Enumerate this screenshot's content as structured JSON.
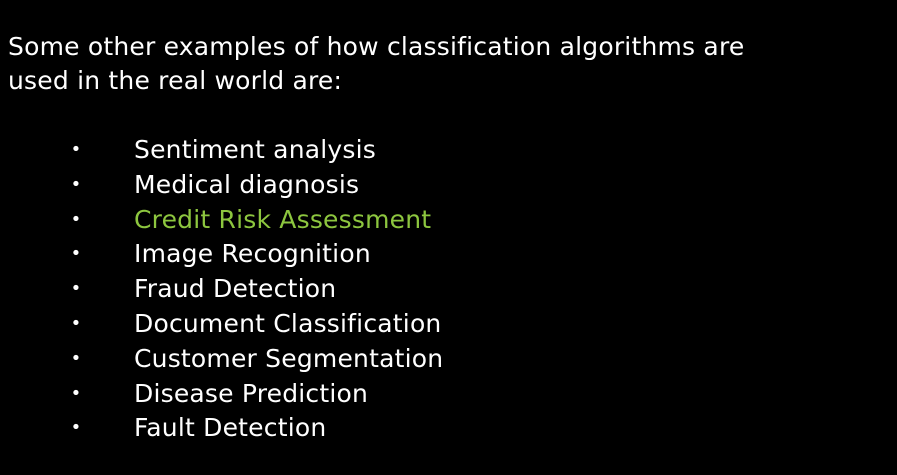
{
  "intro": {
    "line1": "Some other examples of how classification algorithms are",
    "line2": "used in the real world are:"
  },
  "bullet_symbol": "•",
  "items": [
    {
      "label": "Sentiment analysis",
      "highlighted": false
    },
    {
      "label": "Medical diagnosis",
      "highlighted": false
    },
    {
      "label": "Credit Risk Assessment",
      "highlighted": true
    },
    {
      "label": "Image Recognition",
      "highlighted": false
    },
    {
      "label": "Fraud Detection",
      "highlighted": false
    },
    {
      "label": "Document Classification",
      "highlighted": false
    },
    {
      "label": "Customer Segmentation",
      "highlighted": false
    },
    {
      "label": "Disease Prediction",
      "highlighted": false
    },
    {
      "label": "Fault Detection",
      "highlighted": false
    }
  ],
  "colors": {
    "background": "#000000",
    "text": "#ffffff",
    "highlight": "#8dc63f"
  }
}
